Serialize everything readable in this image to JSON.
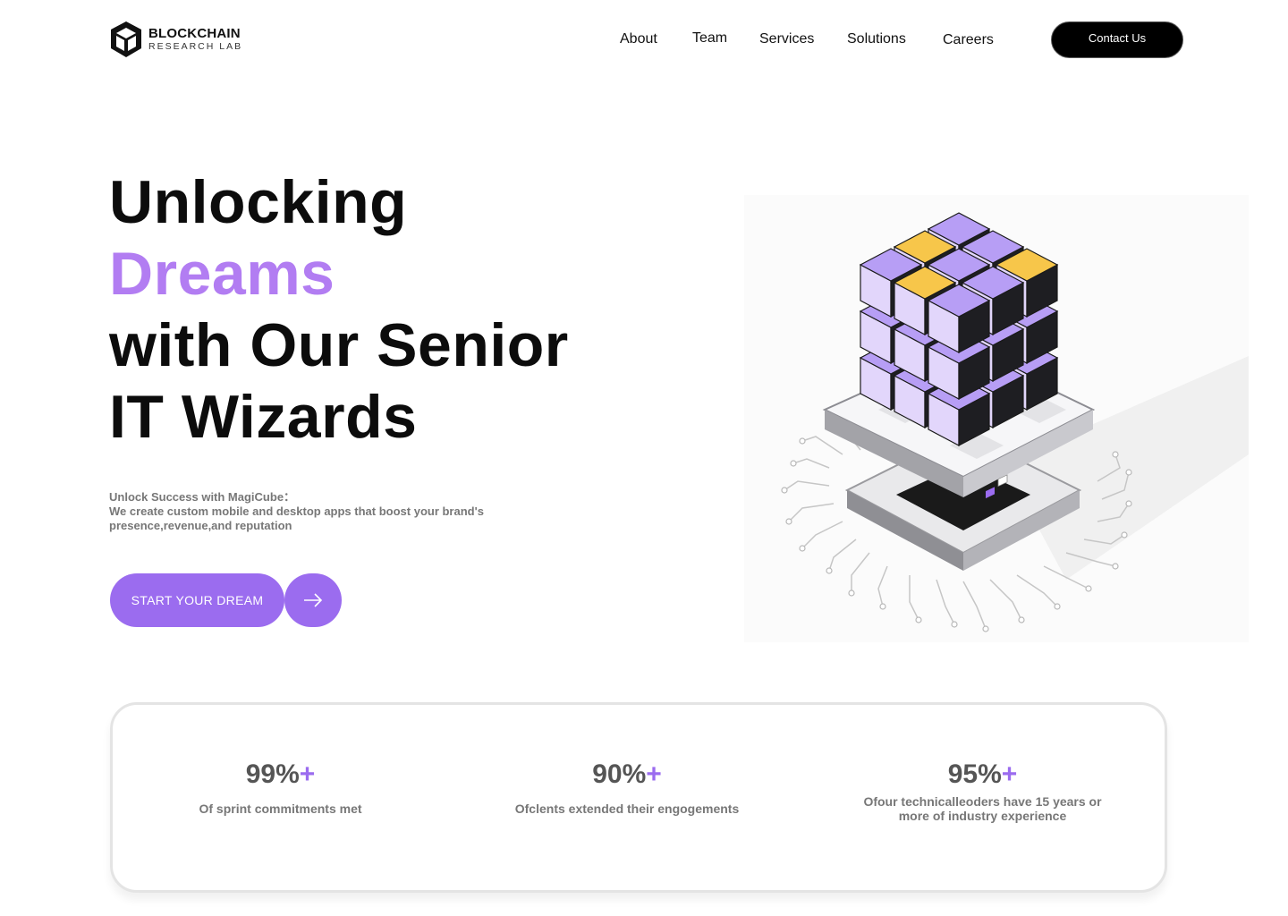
{
  "brand": {
    "title": "BLOCKCHAIN",
    "subtitle": "RESEARCH LAB"
  },
  "nav": {
    "items": [
      "About",
      "Team",
      "Services",
      "Solutions",
      "Careers"
    ],
    "contact_label": "Contact Us"
  },
  "hero": {
    "title_line1": "Unlocking",
    "title_line2": "Dreams",
    "title_line3": "with Our Senior",
    "title_line4": "IT Wizards",
    "sub_line1": "Unlock Success with MagiCube：",
    "sub_line2": "We create custom mobile and desktop apps that boost your brand's presence,revenue,and reputation",
    "cta_label": "START YOUR DREAM"
  },
  "stats": [
    {
      "number": "99%",
      "plus": "+",
      "label": "Of sprint commitments met"
    },
    {
      "number": "90%",
      "plus": "+",
      "label": "Ofclents extended their engogements"
    },
    {
      "number": "95%",
      "plus": "+",
      "label": "Ofour technicalleoders have 15 years or more of industry experience"
    }
  ],
  "colors": {
    "accent": "#9b6cef",
    "title_accent": "#b27df2",
    "cube_face": "#b79ef5",
    "cube_highlight": "#f7c64a"
  },
  "icons": {
    "logo": "cube-logo-icon",
    "cta": "arrow-right-icon"
  }
}
